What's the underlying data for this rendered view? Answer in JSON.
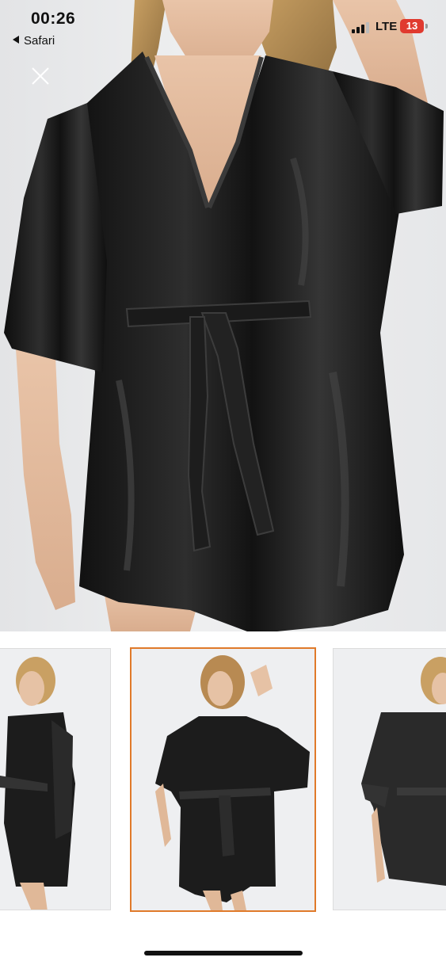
{
  "status_bar": {
    "time": "00:26",
    "back_app": "Safari",
    "network": "LTE",
    "battery": "13"
  },
  "main_image": {
    "subject": "black satin robe with belt, model photo",
    "close_icon": "close-icon"
  },
  "thumbnails": [
    {
      "subject": "model in black satin robe, side view",
      "selected": false
    },
    {
      "subject": "model in black satin robe, front view",
      "selected": true
    },
    {
      "subject": "model in black satin robe, partial view",
      "selected": false
    }
  ],
  "colors": {
    "selected_border": "#e07a2a",
    "battery_low": "#e03a2f",
    "robe": "#1c1c1c"
  }
}
